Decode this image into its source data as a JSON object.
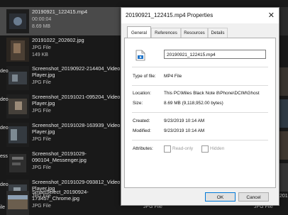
{
  "files": [
    {
      "name": "20190921_122415.mp4",
      "sub1": "00:00:04",
      "sub2": "8.69 MB"
    },
    {
      "name": "20191022_202602.jpg",
      "sub1": "JPG File",
      "sub2": "149 KB"
    },
    {
      "name": "Screenshot_20190922-214404_Video Player.jpg",
      "sub1": "JPG File"
    },
    {
      "name": "Screenshot_20191021-095204_Video Player.jpg",
      "sub1": "JPG File"
    },
    {
      "name": "Screenshot_20191028-163939_Video Player.jpg",
      "sub1": "JPG File"
    },
    {
      "name": "Screenshot_20191029-090104_Messenger.jpg",
      "sub1": "JPG File"
    },
    {
      "name": "Screenshot_20191029-093812_Video Player.jpg",
      "sub1": "JPG File"
    },
    {
      "name": "SmartSelect_20190924-173457_Chrome.jpg",
      "sub1": "JPG File"
    }
  ],
  "edge_labels": [
    "deo",
    "deo",
    "deo",
    "ess",
    "deo",
    "ile"
  ],
  "right_col": {
    "top_text": "5",
    "bottom": {
      "a": "SmartSelect_20190927_11",
      "b": "JPG File",
      "c": "JPG File"
    }
  },
  "dialog": {
    "title": "20190921_122415.mp4 Properties",
    "close_glyph": "✕",
    "tabs": [
      "General",
      "References",
      "Resources",
      "Details"
    ],
    "filename": "20190921_122415.mp4",
    "rows": {
      "type_label": "Type of file:",
      "type_value": "MP4 File",
      "location_label": "Location:",
      "location_value": "This PC\\Miles Black Note 8\\Phone\\DCIM\\Ghost",
      "size_label": "Size:",
      "size_value": "8.69 MB (9,118,952.00 bytes)",
      "created_label": "Created:",
      "created_value": "9/23/2019 10:14 AM",
      "modified_label": "Modified:",
      "modified_value": "9/23/2019 10:14 AM",
      "attributes_label": "Attributes:",
      "readonly_label": "Read-only",
      "hidden_label": "Hidden"
    },
    "ok_label": "OK",
    "cancel_label": "Cancel"
  }
}
